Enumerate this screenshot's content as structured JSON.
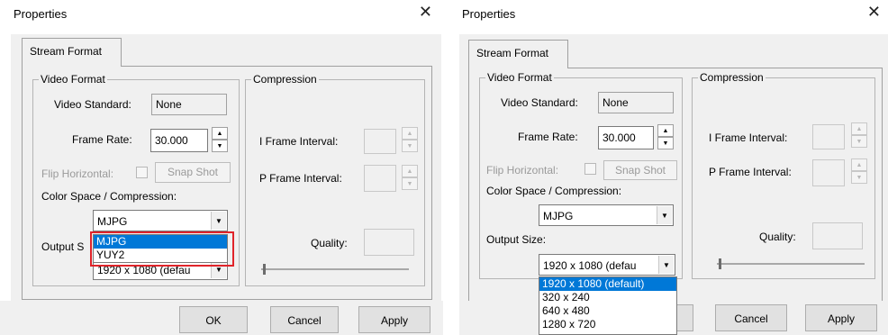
{
  "dialog1": {
    "title": "Properties",
    "close_glyph": "✕",
    "tab_label": "Stream Format",
    "video_format": {
      "group_label": "Video Format",
      "video_standard_label": "Video Standard:",
      "video_standard_value": "None",
      "frame_rate_label": "Frame Rate:",
      "frame_rate_value": "30.000",
      "flip_horizontal_label": "Flip Horizontal:",
      "snap_shot_label": "Snap Shot",
      "color_space_label": "Color Space / Compression:",
      "color_space_value": "MJPG",
      "color_space_options": [
        "MJPG",
        "YUY2"
      ],
      "output_size_label_partial": "Output S",
      "output_size_value": "1920 x 1080  (defau"
    },
    "compression": {
      "group_label": "Compression",
      "i_frame_label": "I Frame Interval:",
      "p_frame_label": "P Frame Interval:",
      "quality_label": "Quality:"
    },
    "buttons": {
      "ok": "OK",
      "cancel": "Cancel",
      "apply": "Apply"
    },
    "highlight_color": "#e0242a"
  },
  "dialog2": {
    "title": "Properties",
    "close_glyph": "✕",
    "tab_label": "Stream Format",
    "video_format": {
      "group_label": "Video Format",
      "video_standard_label": "Video Standard:",
      "video_standard_value": "None",
      "frame_rate_label": "Frame Rate:",
      "frame_rate_value": "30.000",
      "flip_horizontal_label": "Flip Horizontal:",
      "snap_shot_label": "Snap Shot",
      "color_space_label": "Color Space / Compression:",
      "color_space_value": "MJPG",
      "output_size_label": "Output Size:",
      "output_size_value": "1920 x 1080  (defau",
      "output_size_options": [
        "1920 x 1080  (default)",
        "320 x 240",
        "640 x 480",
        "1280 x 720"
      ]
    },
    "compression": {
      "group_label": "Compression",
      "i_frame_label": "I Frame Interval:",
      "p_frame_label": "P Frame Interval:",
      "quality_label": "Quality:"
    },
    "buttons": {
      "cancel": "Cancel",
      "apply": "Apply"
    }
  },
  "colors": {
    "selection": "#0078d7",
    "dialog_bg": "#f0f0f0"
  }
}
